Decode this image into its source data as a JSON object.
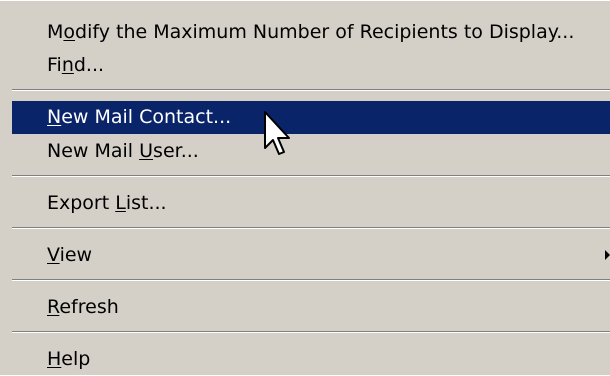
{
  "colors": {
    "menu_background": "#d4d0c8",
    "highlight_background": "#0a246a",
    "highlight_text": "#ffffff",
    "text": "#000000"
  },
  "menu": {
    "items": [
      {
        "pre": "M",
        "accel": "o",
        "post": "dify the Maximum Number of Recipients to Display...",
        "highlighted": false
      },
      {
        "pre": "Fi",
        "accel": "n",
        "post": "d...",
        "highlighted": false
      },
      {
        "pre": "",
        "accel": "N",
        "post": "ew Mail Contact...",
        "highlighted": true
      },
      {
        "pre": "New Mail ",
        "accel": "U",
        "post": "ser...",
        "highlighted": false
      },
      {
        "pre": "Export ",
        "accel": "L",
        "post": "ist...",
        "highlighted": false
      },
      {
        "pre": "",
        "accel": "V",
        "post": "iew",
        "highlighted": false,
        "submenu_icon": "chevron-right-icon"
      },
      {
        "pre": "",
        "accel": "R",
        "post": "efresh",
        "highlighted": false
      },
      {
        "pre": "",
        "accel": "H",
        "post": "elp",
        "highlighted": false
      }
    ]
  },
  "cursor_icon": "mouse-pointer-icon"
}
